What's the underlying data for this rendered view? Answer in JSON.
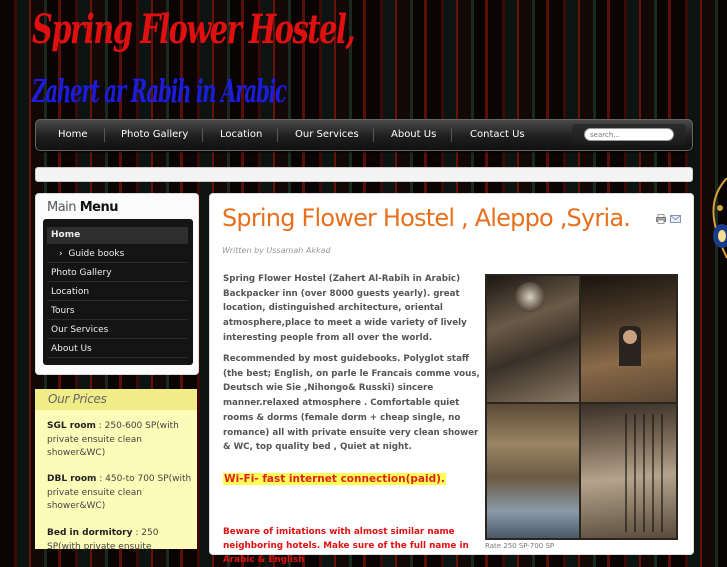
{
  "header": {
    "title_line1": "Spring Flower Hostel,",
    "title_line2": "Zahert ar Rabih in Arabic"
  },
  "nav": {
    "items": [
      "Home",
      "Photo Gallery",
      "Location",
      "Our Services",
      "About Us",
      "Contact Us"
    ],
    "search_placeholder": "search..."
  },
  "sidebar": {
    "title_light": "Main",
    "title_bold": "Menu",
    "items": [
      "Home",
      "Guide books",
      "Photo Gallery",
      "Location",
      "Tours",
      "Our Services",
      "About Us"
    ]
  },
  "prices": {
    "title": "Our Prices",
    "items": [
      {
        "label": "SGL room",
        "text": " : 250-600 SP(with private ensuite clean shower&WC)"
      },
      {
        "label": "DBL room",
        "text": " : 450-to 700 SP(with private ensuite clean shower&WC)"
      },
      {
        "label": "Bed in dormitory",
        "text": " : 250 SP(with private ensuite"
      }
    ]
  },
  "article": {
    "title": "Spring Flower Hostel , Aleppo ,Syria.",
    "author": "Written by Ussamah Akkad",
    "para1": "Spring Flower Hostel (Zahert Al-Rabih in Arabic) Backpacker inn (over 8000 guests yearly). great location, distinguished architecture, oriental atmosphere,place to meet a wide variety of lively interesting people from all over the world.",
    "para2": "Recommended by most guidebooks. Polyglot staff (the best; English, on parle le Francais comme vous, Deutsch wie Sie ,Nihongo& Russki) sincere manner.relaxed atmosphere . Comfortable quiet rooms & dorms (female dorm + cheap single, no romance) all with private ensuite very clean shower & WC, top quality bed , Quiet at night.",
    "wifi": "Wi-Fi- fast internet connection(paid).",
    "warning": "Beware of imitations with almost similar name neighboring hotels. Make sure of the full name in Arabic & English",
    "photo_caption": "Rate 250 SP-700 SP"
  },
  "colors": {
    "title_red": "#e01010",
    "title_blue": "#1c1cdd",
    "article_title": "#e8701c",
    "prices_bg": "#fdfbb8"
  }
}
